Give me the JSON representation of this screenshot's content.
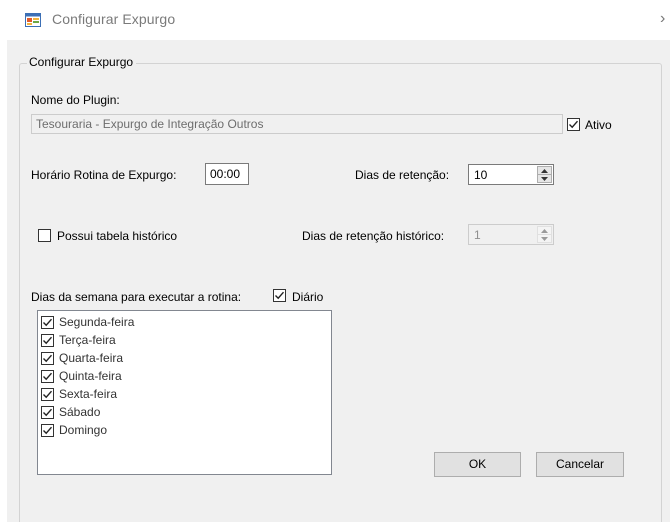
{
  "window": {
    "title": "Configurar Expurgo",
    "icon": "app-form-icon",
    "close_glyph": "›"
  },
  "group": {
    "legend": "Configurar Expurgo"
  },
  "plugin": {
    "label": "Nome do Plugin:",
    "value": "Tesouraria - Expurgo de Integração Outros",
    "ativo_label": "Ativo",
    "ativo_checked": true
  },
  "rotina": {
    "horario_label": "Horário Rotina de Expurgo:",
    "horario_value": "00:00",
    "retencao_label": "Dias de retenção:",
    "retencao_value": "10"
  },
  "historico": {
    "checkbox_label": "Possui tabela histórico",
    "checkbox_checked": false,
    "retencao_label": "Dias de retenção histórico:",
    "retencao_value": "1"
  },
  "semana": {
    "label": "Dias da semana para executar a rotina:",
    "diario_label": "Diário",
    "diario_checked": true,
    "days": [
      {
        "label": "Segunda-feira",
        "checked": true
      },
      {
        "label": "Terça-feira",
        "checked": true
      },
      {
        "label": "Quarta-feira",
        "checked": true
      },
      {
        "label": "Quinta-feira",
        "checked": true
      },
      {
        "label": "Sexta-feira",
        "checked": true
      },
      {
        "label": "Sábado",
        "checked": true
      },
      {
        "label": "Domingo",
        "checked": true
      }
    ]
  },
  "buttons": {
    "ok": "OK",
    "cancel": "Cancelar"
  },
  "colors": {
    "client_bg": "#f0f0f0",
    "title_text": "#7a7a7a",
    "button_bg": "#e1e1e1",
    "disabled_text": "#6d6d6d"
  }
}
